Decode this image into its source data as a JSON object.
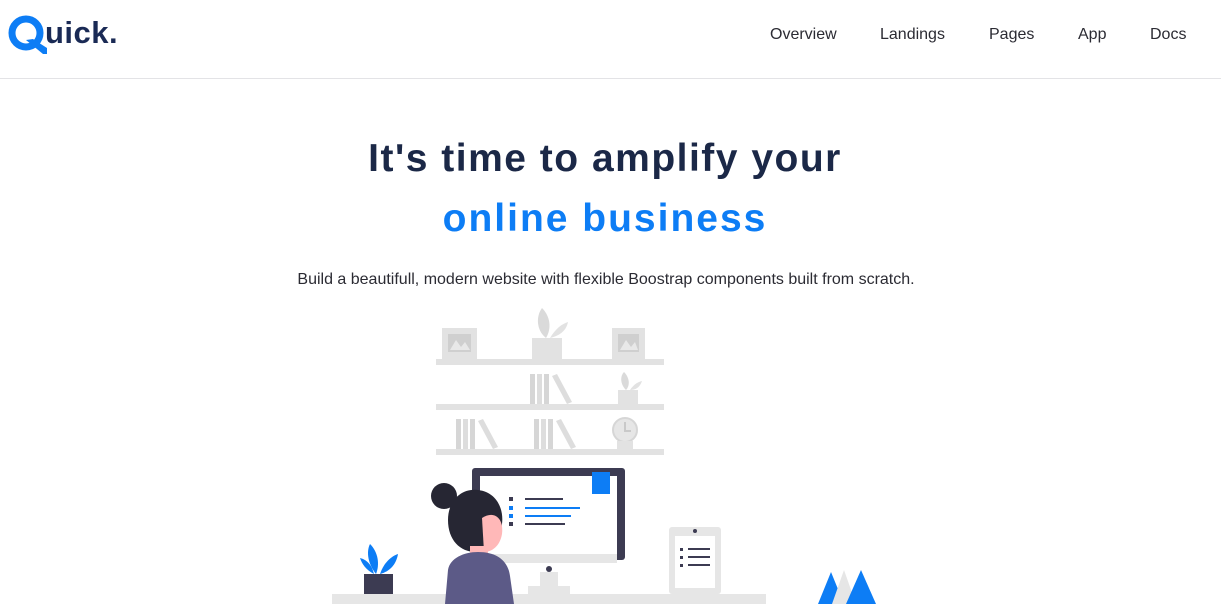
{
  "brand": {
    "logo_text": "uick.",
    "logo_letter": "Q",
    "color": "#1a2a55",
    "accent": "#0d7df5"
  },
  "nav": {
    "items": [
      {
        "label": "Overview"
      },
      {
        "label": "Landings"
      },
      {
        "label": "Pages"
      },
      {
        "label": "App"
      },
      {
        "label": "Docs"
      }
    ]
  },
  "hero": {
    "title_line1": "It's time to amplify your",
    "title_line2": "online business",
    "subtitle": "Build a beautifull, modern website with flexible Boostrap components built from scratch.",
    "title_color": "#1b2847",
    "highlight_color": "#0d7df5"
  },
  "illustration": {
    "icon": "woman-at-desk-illustration"
  }
}
